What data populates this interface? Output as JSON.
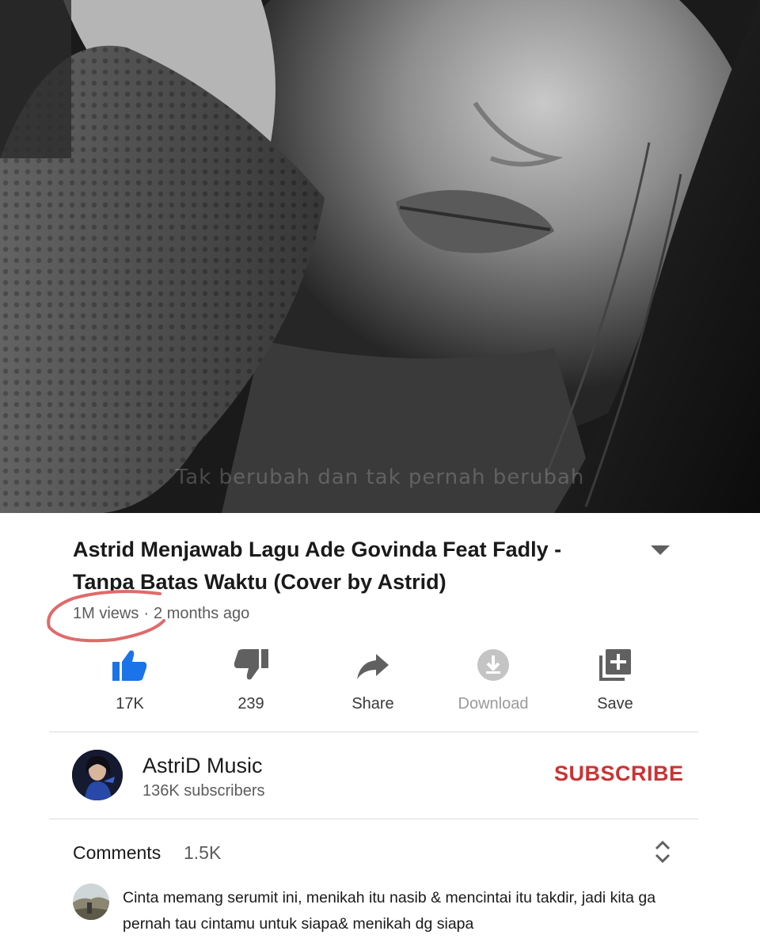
{
  "video": {
    "subtitle_text": "Tak berubah dan tak pernah berubah"
  },
  "title": {
    "text": "Astrid Menjawab Lagu Ade Govinda Feat Fadly - Tanpa Batas Waktu (Cover by Astrid)"
  },
  "meta": {
    "views": "1M views",
    "separator": "·",
    "age": "2 months ago"
  },
  "actions": {
    "like": {
      "label": "17K",
      "icon": "thumbs-up-icon",
      "color": "#1a73e8"
    },
    "dislike": {
      "label": "239",
      "icon": "thumbs-down-icon"
    },
    "share": {
      "label": "Share",
      "icon": "share-arrow-icon"
    },
    "download": {
      "label": "Download",
      "icon": "download-icon"
    },
    "save": {
      "label": "Save",
      "icon": "add-to-playlist-icon"
    }
  },
  "channel": {
    "name": "AstriD Music",
    "subscribers": "136K subscribers",
    "subscribe_label": "SUBSCRIBE",
    "subscribe_color": "#cc3333"
  },
  "comments": {
    "label": "Comments",
    "count": "1.5K",
    "top_comment": "Cinta memang serumit ini, menikah itu nasib & mencintai itu takdir, jadi kita ga pernah tau cintamu untuk siapa& menikah dg siapa"
  }
}
